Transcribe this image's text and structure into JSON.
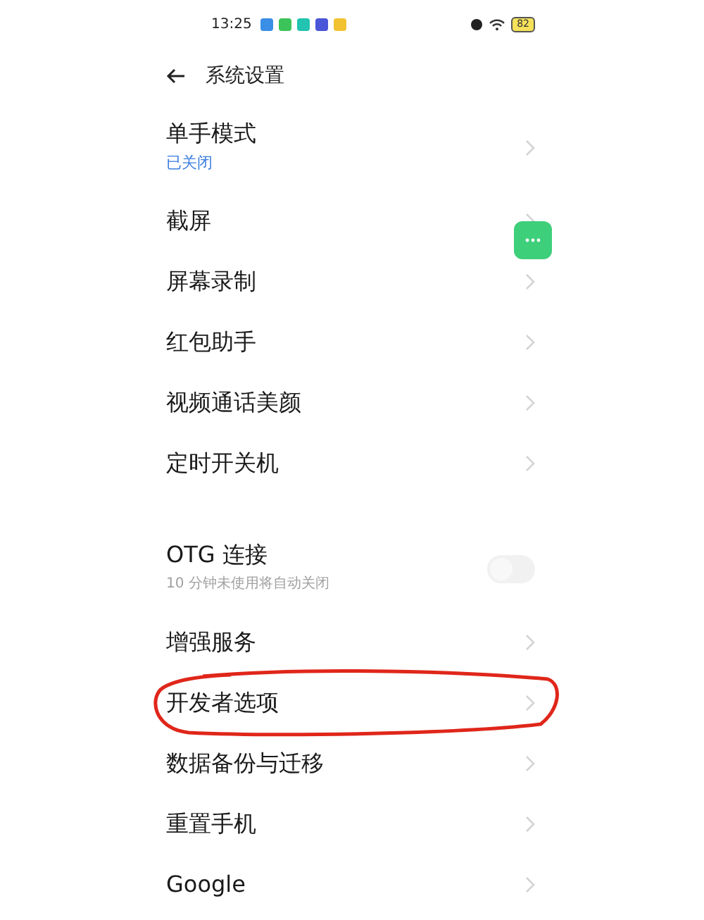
{
  "status_bar": {
    "time": "13:25",
    "app_icons": [
      {
        "color": "#3a8ee6"
      },
      {
        "color": "#3cc45a"
      },
      {
        "color": "#22c3b0"
      },
      {
        "color": "#4a55d8"
      },
      {
        "color": "#f2c230"
      }
    ],
    "battery": "82"
  },
  "header": {
    "title": "系统设置"
  },
  "sections": [
    {
      "items": [
        {
          "kind": "nav",
          "title": "单手模式",
          "subtitle": "已关闭",
          "circled": false
        },
        {
          "kind": "nav",
          "title": "截屏",
          "circled": false
        },
        {
          "kind": "nav",
          "title": "屏幕录制",
          "circled": false
        },
        {
          "kind": "nav",
          "title": "红包助手",
          "circled": false
        },
        {
          "kind": "nav",
          "title": "视频通话美颜",
          "circled": false
        },
        {
          "kind": "nav",
          "title": "定时开关机",
          "circled": false
        }
      ]
    },
    {
      "items": [
        {
          "kind": "toggle",
          "title": "OTG 连接",
          "subtitle": "10 分钟未使用将自动关闭",
          "on": false,
          "circled": false
        },
        {
          "kind": "nav",
          "title": "增强服务",
          "circled": false
        },
        {
          "kind": "nav",
          "title": "开发者选项",
          "circled": true
        },
        {
          "kind": "nav",
          "title": "数据备份与迁移",
          "circled": false
        },
        {
          "kind": "nav",
          "title": "重置手机",
          "circled": false
        },
        {
          "kind": "nav",
          "title": "Google",
          "circled": false
        }
      ]
    }
  ],
  "floating_button": {
    "visible": true
  }
}
